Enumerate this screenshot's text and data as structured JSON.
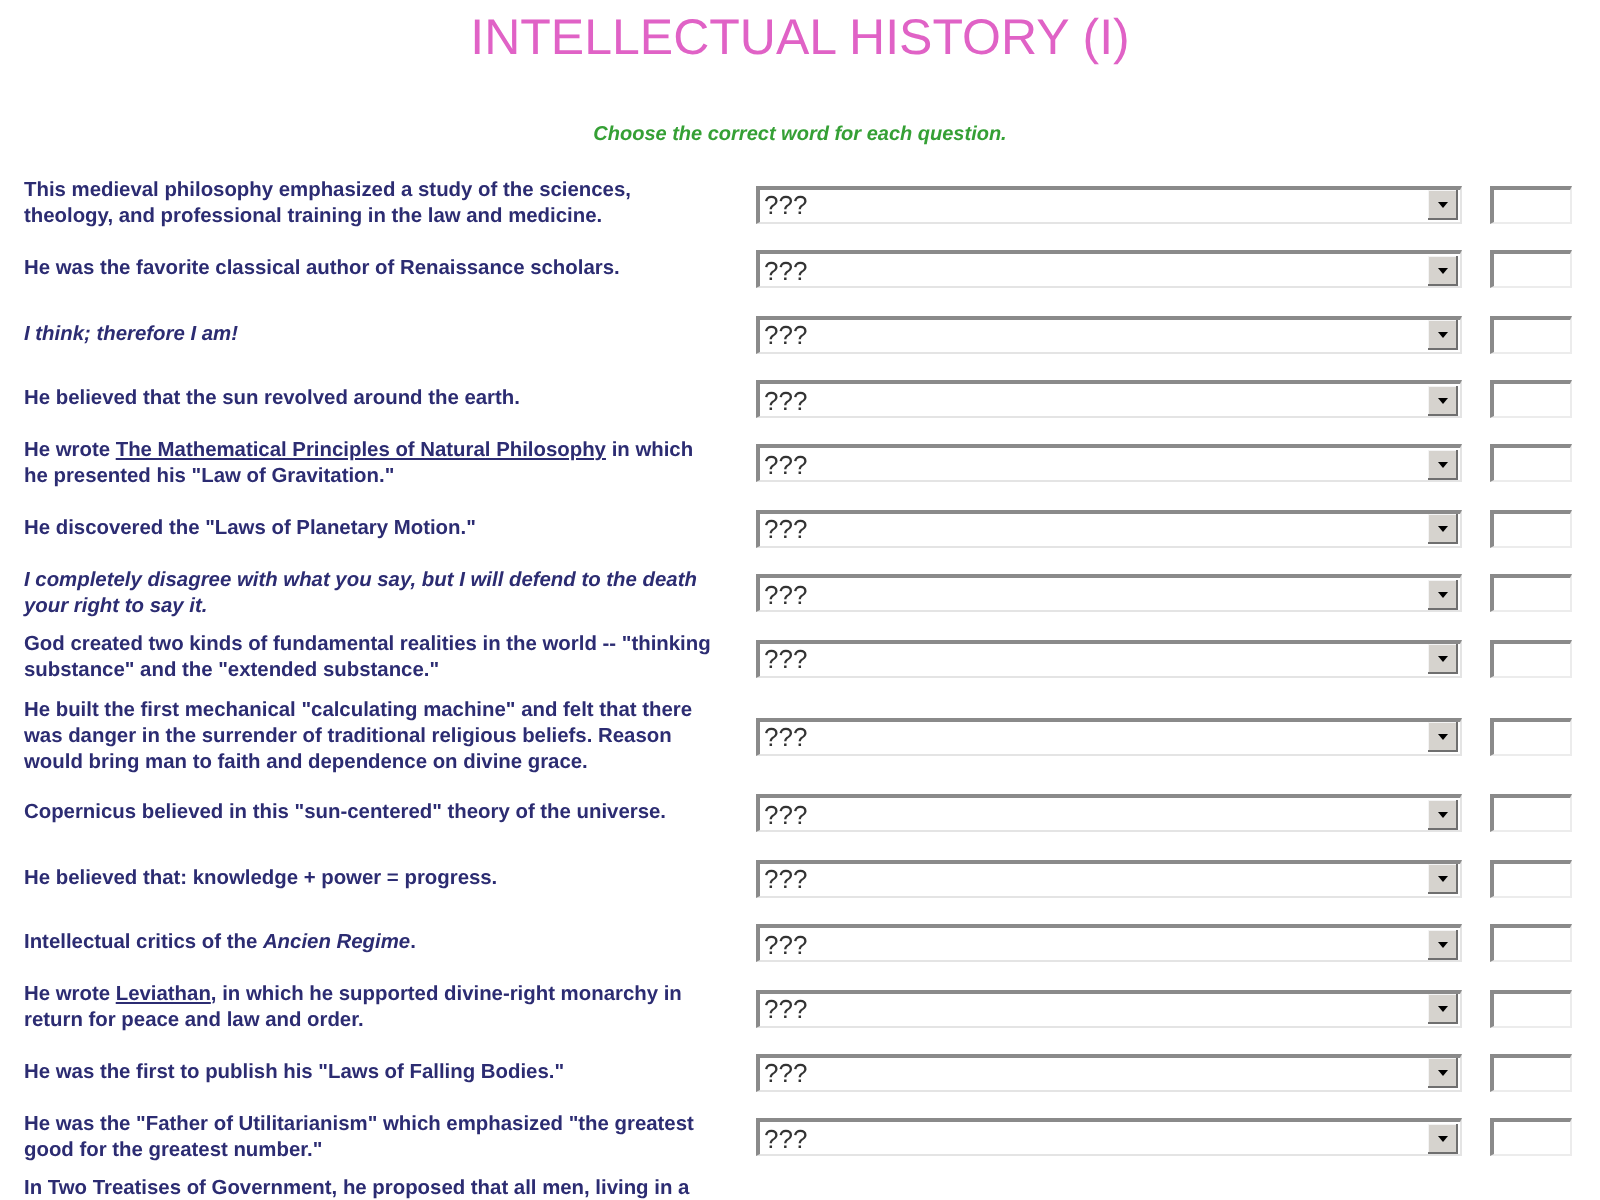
{
  "page": {
    "title": "INTELLECTUAL HISTORY (I)",
    "instruction": "Choose the correct word for each question."
  },
  "questions": [
    {
      "text": "This medieval philosophy emphasized a study of the sciences, theology, and professional training in the law and medicine.",
      "italic": false,
      "choice": "???"
    },
    {
      "text": "He was the favorite classical author of Renaissance scholars.",
      "italic": false,
      "choice": "???"
    },
    {
      "text": "I think; therefore I am!",
      "italic": true,
      "choice": "???"
    },
    {
      "text": "He believed that the sun revolved around the earth.",
      "italic": false,
      "choice": "???"
    },
    {
      "text": "He wrote ",
      "title": "The Mathematical Principles of Natural Philosophy",
      "text_after": " in which he presented his \"Law of Gravitation.\"",
      "italic": false,
      "choice": "???"
    },
    {
      "text": "He discovered the \"Laws of Planetary Motion.\"",
      "italic": false,
      "choice": "???"
    },
    {
      "text": "I completely disagree with what you say, but I will defend to the death your right to say it.",
      "italic": true,
      "choice": "???"
    },
    {
      "text": "God created two kinds of fundamental realities in the world -- \"thinking substance\" and the \"extended substance.\"",
      "italic": false,
      "choice": "???"
    },
    {
      "text": "He built the first mechanical \"calculating machine\" and felt that there was danger in the surrender of traditional religious beliefs. Reason would bring man to faith and dependence on divine grace.",
      "italic": false,
      "choice": "???"
    },
    {
      "text": "Copernicus believed in this \"sun-centered\" theory of the universe.",
      "italic": false,
      "choice": "???"
    },
    {
      "text": "He believed that: knowledge + power = progress.",
      "italic": false,
      "choice": "???"
    },
    {
      "text": "Intellectual critics of the *Ancien Regime*.",
      "italic": false,
      "choice": "???"
    },
    {
      "text": "He wrote ",
      "title": "Leviathan",
      "text_after": ", in which he supported divine-right monarchy in return for peace and law and order.",
      "italic": false,
      "choice": "???"
    },
    {
      "text": "He was the first to publish his \"Laws of Falling Bodies.\"",
      "italic": false,
      "choice": "???"
    },
    {
      "text": "He was the \"Father of Utilitarianism\" which emphasized \"the greatest good for the greatest number.\"",
      "italic": false,
      "choice": "???"
    },
    {
      "text": "In Two Treatises of Government, he proposed that all men, living in a",
      "italic": false
    }
  ]
}
